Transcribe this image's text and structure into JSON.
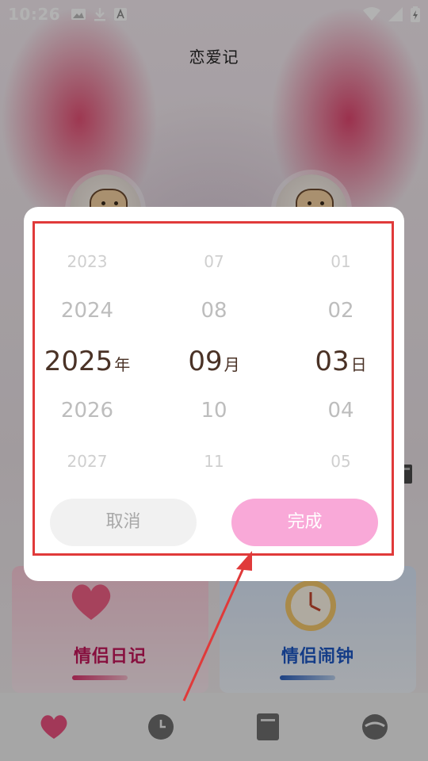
{
  "status_bar": {
    "time": "10:26"
  },
  "app": {
    "title": "恋爱记"
  },
  "cards": [
    {
      "label": "情侣日记",
      "accent": "#c2165a"
    },
    {
      "label": "情侣闹钟",
      "accent": "#1d57c2"
    }
  ],
  "date_picker": {
    "years": [
      "2023",
      "2024",
      "2025",
      "2026",
      "2027"
    ],
    "months": [
      "07",
      "08",
      "09",
      "10",
      "11"
    ],
    "days": [
      "01",
      "02",
      "03",
      "04",
      "05"
    ],
    "selected_index": 2,
    "year_unit": "年",
    "month_unit": "月",
    "day_unit": "日",
    "cancel_label": "取消",
    "done_label": "完成"
  },
  "bottom_nav": {
    "items": [
      {
        "icon": "heart-icon"
      },
      {
        "icon": "clock-icon"
      },
      {
        "icon": "book-icon"
      },
      {
        "icon": "profile-icon"
      }
    ]
  },
  "colors": {
    "highlight": "#e03a3a",
    "done_button": "#f9a9d8",
    "selected_text": "#4a3226"
  }
}
